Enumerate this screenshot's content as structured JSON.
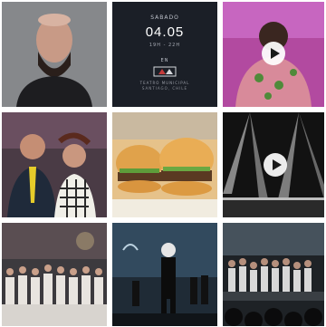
{
  "grid": {
    "tiles": [
      {
        "type": "photo",
        "subject": "portrait"
      },
      {
        "type": "card",
        "line1": "SABADO",
        "date": "04.05",
        "time": "19H - 22H",
        "line2": "EN",
        "venue": "TEATRO MUNICIPAL",
        "address": "SANTIAGO, CHILE"
      },
      {
        "type": "video",
        "icon": "play-icon"
      },
      {
        "type": "photo",
        "subject": "couple-selfie"
      },
      {
        "type": "photo",
        "subject": "burgers"
      },
      {
        "type": "video",
        "icon": "play-icon"
      },
      {
        "type": "photo",
        "subject": "group-photo"
      },
      {
        "type": "photo",
        "subject": "stage-speaker"
      },
      {
        "type": "photo",
        "subject": "crowd-on-stage"
      }
    ]
  },
  "colors": {
    "card_bg": "#1b1f27",
    "play_bg": "#ffffff"
  }
}
